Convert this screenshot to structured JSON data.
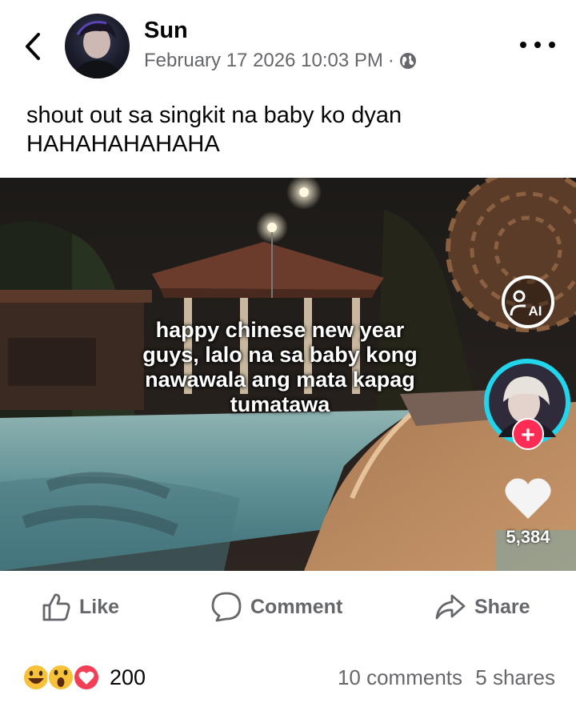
{
  "post": {
    "author": "Sun",
    "date": "February 17 2026 10:03 PM",
    "separator": "·",
    "privacy_icon": "globe-icon",
    "caption_lines": [
      "shout out sa singkit na baby ko dyan",
      "HAHAHAHAHAHA"
    ]
  },
  "media": {
    "overlay_lines": [
      "happy chinese new year",
      "guys, lalo na sa baby kong",
      "nawawala ang mata kapag",
      "tumatawa"
    ],
    "ai_badge": "AI",
    "follow_symbol": "+",
    "like_count": "5,384"
  },
  "actions": {
    "like": "Like",
    "comment": "Comment",
    "share": "Share"
  },
  "stats": {
    "reactions": [
      "grin-emoji",
      "wow-emoji",
      "love-emoji"
    ],
    "reaction_count": "200",
    "comments": "10 comments",
    "shares": "5 shares"
  },
  "colors": {
    "text_primary": "#050505",
    "text_secondary": "#65676b",
    "follow_red": "#fe2c55",
    "creator_ring": "#20d5ec"
  }
}
